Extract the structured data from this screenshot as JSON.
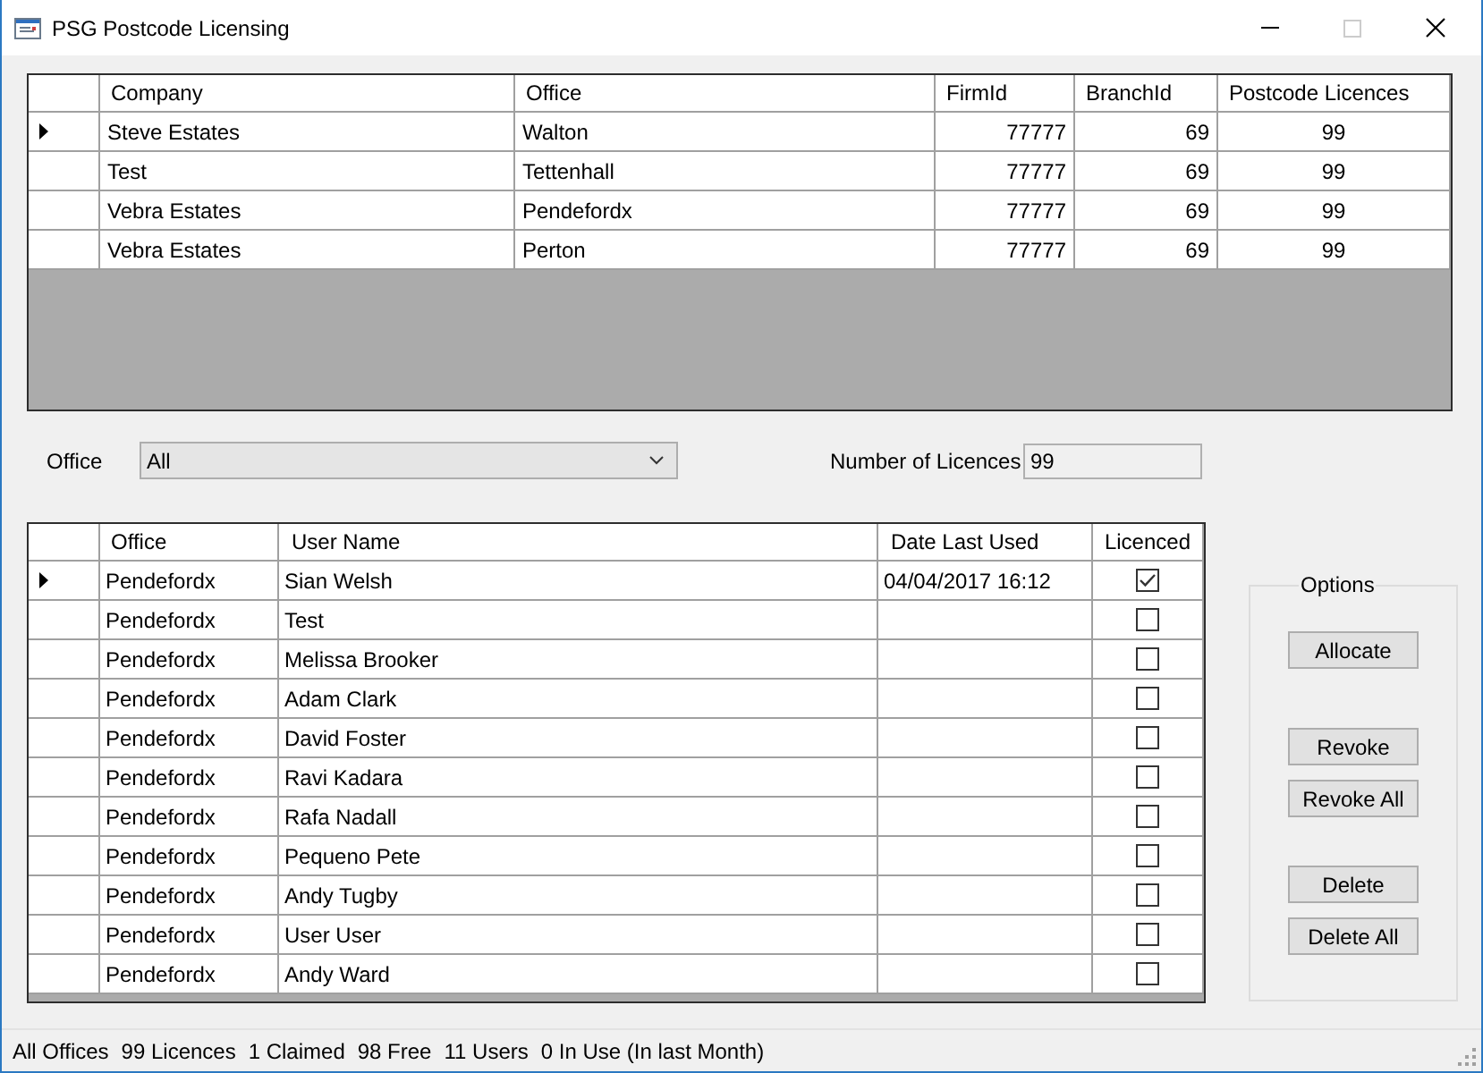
{
  "window": {
    "title": "PSG Postcode Licensing",
    "controls": [
      {
        "kind": "minimize",
        "disabled": false
      },
      {
        "kind": "maximize",
        "disabled": true
      },
      {
        "kind": "close",
        "disabled": false
      }
    ]
  },
  "companies_table": {
    "columns": [
      "Company",
      "Office",
      "FirmId",
      "BranchId",
      "Postcode Licences"
    ],
    "rows": [
      {
        "selected": true,
        "cells": [
          "Steve Estates",
          "Walton",
          "77777",
          "69",
          "99"
        ]
      },
      {
        "selected": false,
        "cells": [
          "Test",
          "Tettenhall",
          "77777",
          "69",
          "99"
        ]
      },
      {
        "selected": false,
        "cells": [
          "Vebra Estates",
          "Pendefordx",
          "77777",
          "69",
          "99"
        ]
      },
      {
        "selected": false,
        "cells": [
          "Vebra Estates",
          "Perton",
          "77777",
          "69",
          "99"
        ]
      }
    ]
  },
  "office_filter": {
    "label": "Office",
    "value": "All"
  },
  "licences_count": {
    "label": "Number of Licences",
    "value": "99"
  },
  "users_table": {
    "columns": [
      "Office",
      "User Name",
      "Date Last Used",
      "Licenced"
    ],
    "rows": [
      {
        "selected": true,
        "office": "Pendefordx",
        "user_name": "Sian Welsh",
        "date_last_used": "04/04/2017 16:12",
        "licenced": true
      },
      {
        "selected": false,
        "office": "Pendefordx",
        "user_name": "Test",
        "licenced": false
      },
      {
        "selected": false,
        "office": "Pendefordx",
        "user_name": "Melissa Brooker",
        "licenced": false
      },
      {
        "selected": false,
        "office": "Pendefordx",
        "user_name": "Adam Clark",
        "licenced": false
      },
      {
        "selected": false,
        "office": "Pendefordx",
        "user_name": "David Foster",
        "licenced": false
      },
      {
        "selected": false,
        "office": "Pendefordx",
        "user_name": "Ravi Kadara",
        "licenced": false
      },
      {
        "selected": false,
        "office": "Pendefordx",
        "user_name": "Rafa Nadall",
        "licenced": false
      },
      {
        "selected": false,
        "office": "Pendefordx",
        "user_name": "Pequeno Pete",
        "licenced": false
      },
      {
        "selected": false,
        "office": "Pendefordx",
        "user_name": "Andy Tugby",
        "licenced": false
      },
      {
        "selected": false,
        "office": "Pendefordx",
        "user_name": "User User",
        "licenced": false
      },
      {
        "selected": false,
        "office": "Pendefordx",
        "user_name": "Andy Ward",
        "licenced": false
      }
    ]
  },
  "options": {
    "title": "Options",
    "button_groups": [
      [
        "Allocate"
      ],
      [
        "Revoke",
        "Revoke All"
      ],
      [
        "Delete",
        "Delete All"
      ]
    ]
  },
  "status_bar": {
    "items": [
      "All Offices",
      "99 Licences",
      "1 Claimed",
      "98 Free",
      "11 Users",
      "0 In Use (In last Month)"
    ]
  }
}
